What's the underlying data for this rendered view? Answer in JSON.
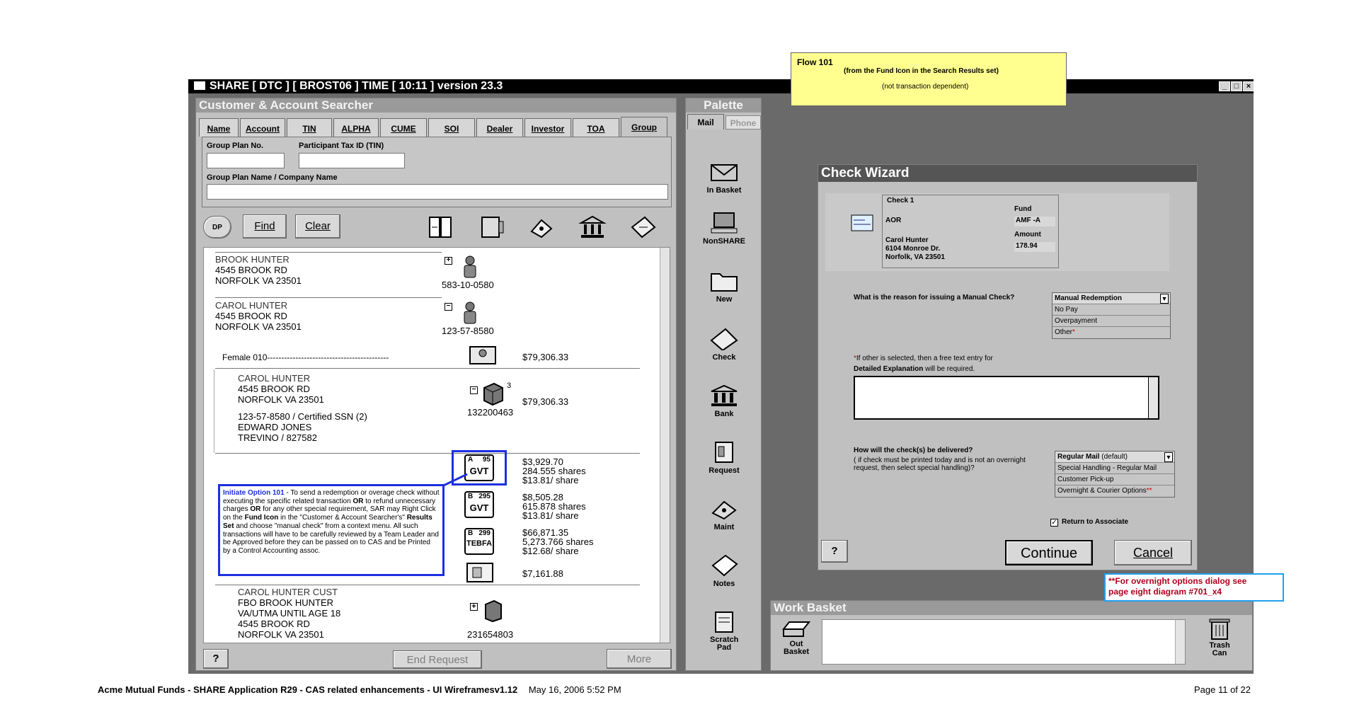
{
  "window": {
    "title": "SHARE  [ DTC ]  [ BROST06 ] TIME [ 10:11 ] version 23.3"
  },
  "searcher": {
    "header": "Customer & Account  Searcher",
    "tabs": [
      "Name",
      "Account",
      "TIN",
      "ALPHA",
      "CUME",
      "SOI",
      "Dealer",
      "Investor",
      "TOA",
      "Group"
    ],
    "group_plan_label": "Group Plan No.",
    "participant_tin_label": "Participant Tax ID (TIN)",
    "group_plan_name_label": "Group Plan Name / Company Name",
    "dp_label": "DP",
    "find_label": "Find",
    "clear_label": "Clear",
    "end_request_label": "End Request",
    "more_label": "More",
    "help_label": "?"
  },
  "results": {
    "entries": [
      {
        "name": "BROOK HUNTER",
        "addr1": "4545 BROOK RD",
        "addr2": "NORFOLK VA  23501",
        "tin": "583-10-0580",
        "expander": "+"
      },
      {
        "name": "CAROL HUNTER",
        "addr1": "4545 BROOK RD",
        "addr2": "NORFOLK VA  23501",
        "tin": "123-57-8580",
        "expander": "−"
      }
    ],
    "female_row": {
      "label": "Female 010-------------------------------------------",
      "amount": "$79,306.33"
    },
    "account": {
      "name": "CAROL HUNTER",
      "addr1": "4545 BROOK RD",
      "addr2": "NORFOLK VA  23501",
      "ssn": "123-57-8580 / Certified SSN (2)",
      "dealer": "EDWARD JONES",
      "rep": "TREVINO / 827582",
      "count": "3",
      "number": "132200463",
      "amount": "$79,306.33"
    },
    "funds": [
      {
        "cls": "A",
        "num": "95",
        "code": "GVT",
        "amount": "$3,929.70",
        "shares": "284.555 shares",
        "price": "$13.81/ share"
      },
      {
        "cls": "B",
        "num": "295",
        "code": "GVT",
        "amount": "$8,505.28",
        "shares": "615.878 shares",
        "price": "$13.81/ share"
      },
      {
        "cls": "B",
        "num": "299",
        "code": "TEBFA",
        "amount": "$66,871.35",
        "shares": "5,273.766 shares",
        "price": "$12.68/ share"
      }
    ],
    "misc_amount": "$7,161.88",
    "cust": {
      "l1": "CAROL HUNTER CUST",
      "l2": "FBO BROOK HUNTER",
      "l3": "VA/UTMA UNTIL AGE 18",
      "l4": "4545 BROOK RD",
      "l5": "NORFOLK VA  23501",
      "number": "231654803"
    }
  },
  "palette": {
    "header": "Palette",
    "tab_mail": "Mail",
    "tab_phone": "Phone",
    "items": [
      "In Basket",
      "NonSHARE",
      "New",
      "Check",
      "Bank",
      "Request",
      "Maint",
      "Notes",
      "Scratch Pad"
    ]
  },
  "work_basket": {
    "header": "Work Basket",
    "out_basket": "Out Basket",
    "trash": "Trash Can"
  },
  "wizard": {
    "title": "Check Wizard",
    "check_label": "Check 1",
    "aor": "AOR",
    "payee_name": "Carol Hunter",
    "payee_addr1": "6104 Monroe Dr.",
    "payee_addr2": "Norfolk, VA 23501",
    "fund_label": "Fund",
    "fund_value": "AMF -A",
    "amount_label": "Amount",
    "amount_value": "178.94",
    "reason_question": "What is the reason for issuing a Manual Check?",
    "reason_options": [
      "Manual Redemption",
      "No Pay",
      "Overpayment",
      "Other"
    ],
    "explain_line1": "If other is selected, then a free text entry for",
    "explain_line2a": "Detailed Explanation",
    "explain_line2b": " will be required.",
    "delivery_question": "How will the check(s) be delivered?",
    "delivery_note1": "( if check must be printed today and is not an overnight",
    "delivery_note2": "request, then select special handling)?",
    "delivery_default": "Regular Mail",
    "delivery_default_suffix": " (default)",
    "delivery_options": [
      "Special Handling - Regular Mail",
      "Customer Pick-up",
      "Overnight & Courier Options"
    ],
    "return_label": "Return to Associate",
    "continue_label": "Continue",
    "cancel_label": "Cancel",
    "help_label": "?"
  },
  "notes": {
    "flow_title": "Flow 101",
    "flow_line1": "(from the Fund Icon in the Search Results set)",
    "flow_line2": "(not transaction dependent)",
    "initiate_title": "Initiate Option 101",
    "initiate_p1": " -  To send a redemption or overage check without executing the specific related transaction ",
    "initiate_or1": "OR",
    "initiate_p2": " to refund unnecessary charges ",
    "initiate_or2": "OR",
    "initiate_p3": " for any other special requirement, SAR may Right Click on the ",
    "initiate_fund": "Fund Icon",
    "initiate_p4": " in the \"Customer & Account Searcher's\" ",
    "initiate_rs": "Results Set",
    "initiate_p5": " and choose \"manual check\" from a context menu. All such transactions will have to be carefully reviewed by a Team Leader and be Approved before they can be passed on to CAS and be Printed by a Control Accounting assoc.",
    "overnight_line1": "**For overnight options dialog see",
    "overnight_line2": "page eight diagram #701_x4"
  },
  "footer": {
    "left_bold": "Acme Mutual Funds - SHARE Application R29 - CAS related enhancements - UI Wireframesv1.12",
    "left_date": "May 16, 2006 5:52 PM",
    "page": "Page 11 of 22"
  },
  "colors": {
    "note_yellow": "#ffff90",
    "note_blue_border": "#1c2fe0",
    "note_red_text": "#b0001c",
    "wizard_title": "#555555"
  }
}
